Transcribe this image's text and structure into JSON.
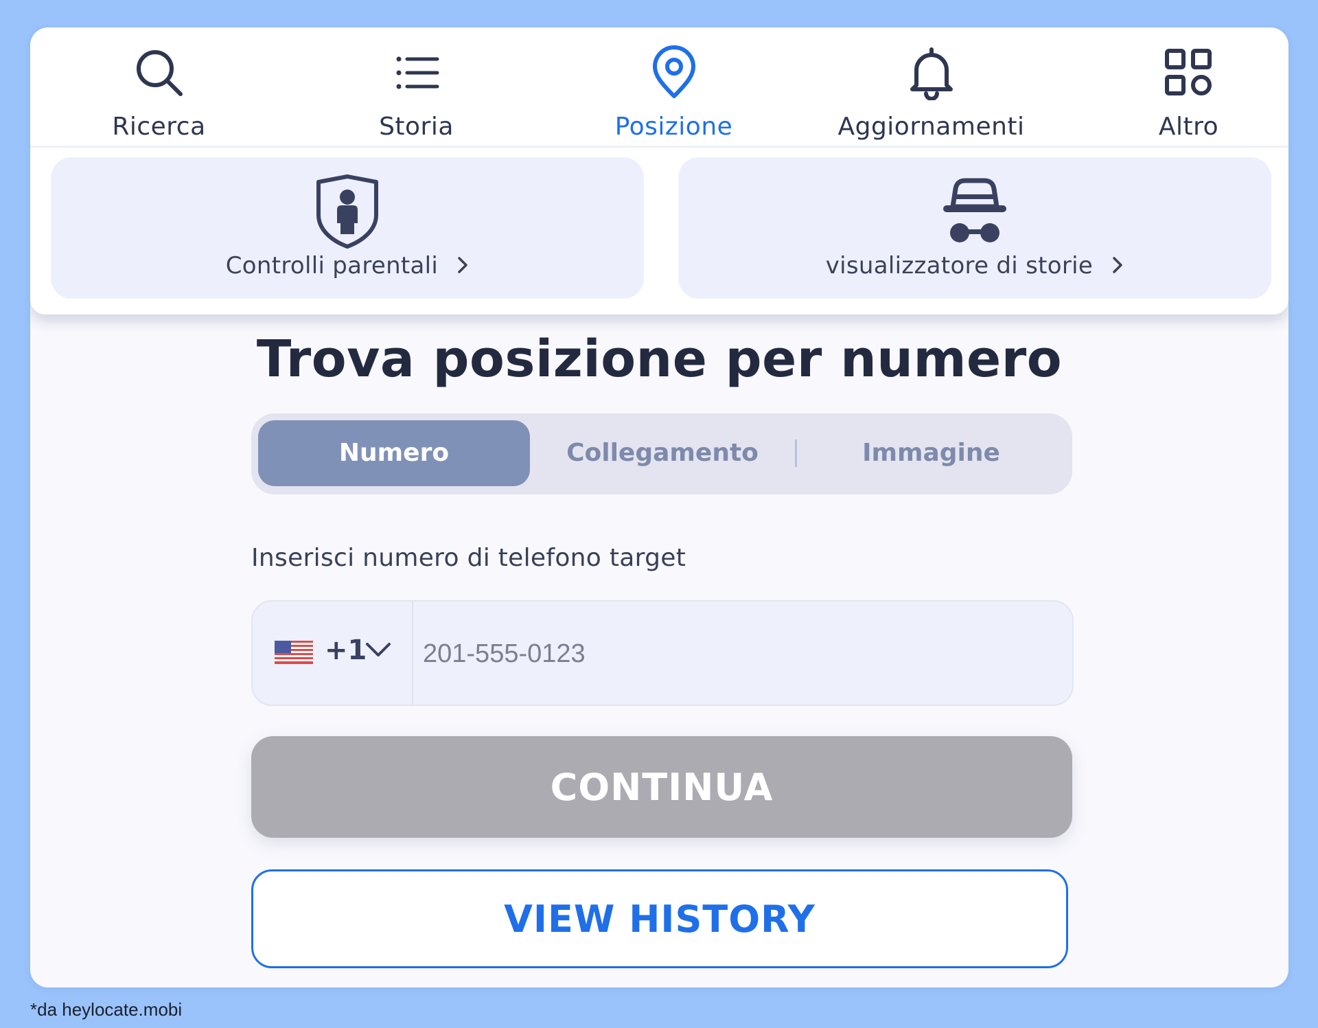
{
  "nav": {
    "tabs": [
      {
        "label": "Ricerca",
        "icon": "search-icon"
      },
      {
        "label": "Storia",
        "icon": "list-icon"
      },
      {
        "label": "Posizione",
        "icon": "location-pin-icon",
        "active": true
      },
      {
        "label": "Aggiornamenti",
        "icon": "bell-icon"
      },
      {
        "label": "Altro",
        "icon": "grid-icon"
      }
    ],
    "features": [
      {
        "label": "Controlli parentali",
        "icon": "shield-person-icon"
      },
      {
        "label": "visualizzatore di storie",
        "icon": "incognito-icon"
      }
    ]
  },
  "main": {
    "title": "Trova posizione per numero",
    "segments": [
      {
        "label": "Numero",
        "active": true
      },
      {
        "label": "Collegamento"
      },
      {
        "label": "Immagine"
      }
    ],
    "phone_label": "Inserisci numero di telefono target",
    "country_code": "+1",
    "country_flag": "us-flag-icon",
    "phone_placeholder": "201-555-0123",
    "continue_label": "CONTINUA",
    "history_label": "VIEW HISTORY"
  },
  "footer": {
    "credit": "*da heylocate.mobi"
  },
  "colors": {
    "accent": "#1f6fe8",
    "page_bg": "#9ac3fb",
    "segment_active": "#8091b7",
    "continue_disabled": "#acabb2"
  }
}
